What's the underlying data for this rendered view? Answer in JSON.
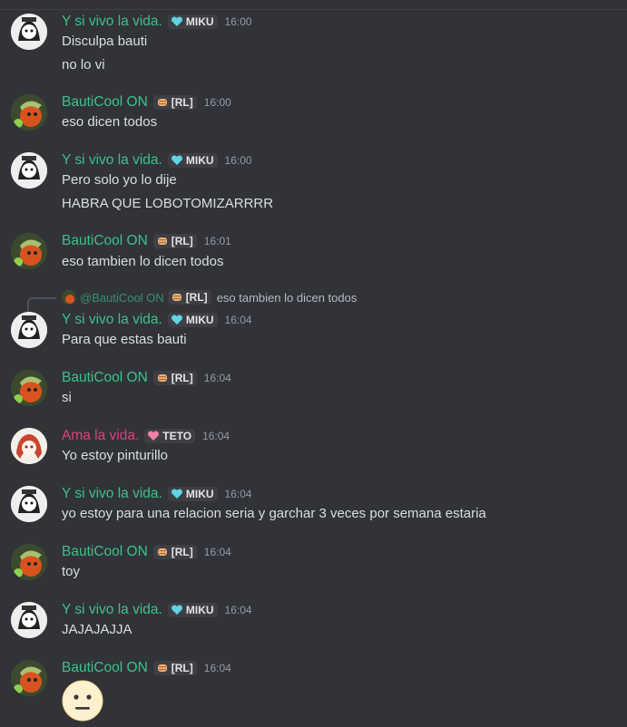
{
  "users": {
    "miku": {
      "name": "Y si vivo la vida.",
      "tag": "MIKU",
      "color": "#3ec08a"
    },
    "bauti": {
      "name": "BautiCool ON",
      "tag": "[RL]",
      "color": "#3ec08a"
    },
    "teto": {
      "name": "Ama la vida.",
      "tag": "TETO",
      "color": "#e23f7e"
    }
  },
  "messages": [
    {
      "author": "Y si vivo la vida.",
      "tag": "MIKU",
      "time": "16:00",
      "lines": [
        "Disculpa bauti",
        "no lo vi"
      ]
    },
    {
      "author": "BautiCool ON",
      "tag": "[RL]",
      "time": "16:00",
      "lines": [
        "eso dicen todos"
      ]
    },
    {
      "author": "Y si vivo la vida.",
      "tag": "MIKU",
      "time": "16:00",
      "lines": [
        "Pero solo yo lo dije",
        "HABRA QUE LOBOTOMIZARRRR"
      ]
    },
    {
      "author": "BautiCool ON",
      "tag": "[RL]",
      "time": "16:01",
      "lines": [
        "eso tambien lo dicen todos"
      ]
    },
    {
      "author": "Y si vivo la vida.",
      "tag": "MIKU",
      "time": "16:04",
      "lines": [
        "Para que estas bauti"
      ],
      "reply": {
        "name": "@BautiCool ON",
        "tag": "[RL]",
        "text": "eso tambien lo dicen todos"
      }
    },
    {
      "author": "BautiCool ON",
      "tag": "[RL]",
      "time": "16:04",
      "lines": [
        "si"
      ]
    },
    {
      "author": "Ama la vida.",
      "tag": "TETO",
      "time": "16:04",
      "lines": [
        "Yo estoy pinturillo"
      ]
    },
    {
      "author": "Y si vivo la vida.",
      "tag": "MIKU",
      "time": "16:04",
      "lines": [
        "yo estoy para una relacion seria y garchar 3 veces por semana estaria"
      ]
    },
    {
      "author": "BautiCool ON",
      "tag": "[RL]",
      "time": "16:04",
      "lines": [
        "toy"
      ]
    },
    {
      "author": "Y si vivo la vida.",
      "tag": "MIKU",
      "time": "16:04",
      "lines": [
        "JAJAJAJJA"
      ]
    },
    {
      "author": "BautiCool ON",
      "tag": "[RL]",
      "time": "16:04",
      "lines": [],
      "emoji": "neutral-face-emoji"
    }
  ]
}
